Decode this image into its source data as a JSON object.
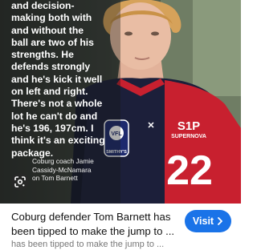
{
  "image": {
    "quote_lines": [
      "and decision-",
      "making both with",
      "and without the",
      "ball are two of his",
      "strengths. He",
      "defends strongly",
      "and he's kick it well",
      "on left and right.",
      "There's not a whole",
      "lot he can't do and",
      "he's 196, 197cm. I",
      "think it's an exciting",
      "package."
    ],
    "caption_lines": [
      "Coburg coach Jamie",
      "Cassidy-McNamara",
      "on Tom Barnett"
    ],
    "jersey": {
      "number": "22",
      "sponsor": "SUPERNOVA",
      "sponsor_mark": "S1P",
      "badge_text": "VFL",
      "badge_sub": "SMITHY'S"
    },
    "colors": {
      "jersey_red": "#c8202f",
      "jersey_navy": "#1c1f3a",
      "text": "#ffffff"
    },
    "lens_icon": "google-lens-icon"
  },
  "result": {
    "headline_lines": [
      "Coburg defender Tom Barnett has",
      "been tipped to make the jump to ..."
    ],
    "faded_line": "has been tipped to make the jump to ...",
    "visit_label": "Visit",
    "visit_icon": "chevron-right-icon",
    "accent_color": "#1a73e8"
  }
}
